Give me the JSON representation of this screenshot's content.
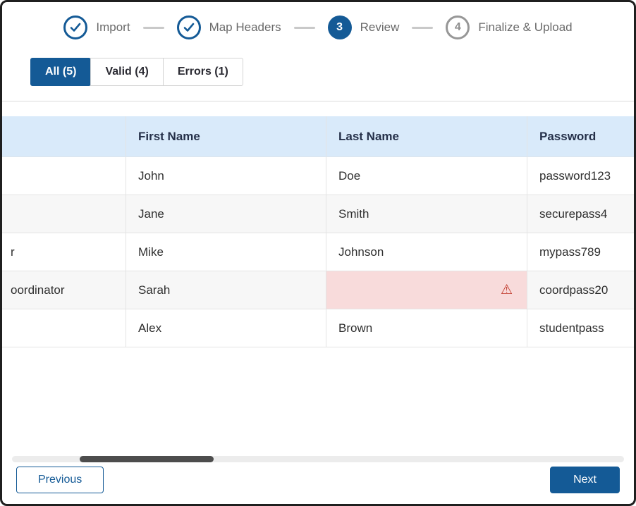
{
  "colors": {
    "primary": "#145a96",
    "table_header_bg": "#d9eafa",
    "row_stripe_bg": "#f7f7f7",
    "error_cell_bg": "#f8dbdb",
    "warning_red": "#c0392b",
    "step_todo_gray": "#8e8e8e"
  },
  "stepper": {
    "steps": [
      {
        "label": "Import",
        "state": "complete"
      },
      {
        "label": "Map Headers",
        "state": "complete"
      },
      {
        "number": "3",
        "label": "Review",
        "state": "active"
      },
      {
        "number": "4",
        "label": "Finalize & Upload",
        "state": "upcoming"
      }
    ]
  },
  "tabs": [
    {
      "label": "All (5)",
      "active": true
    },
    {
      "label": "Valid (4)",
      "active": false
    },
    {
      "label": "Errors (1)",
      "active": false
    }
  ],
  "table": {
    "columns": [
      "",
      "First Name",
      "Last Name",
      "Password"
    ],
    "rows": [
      {
        "col0_fragment": "",
        "first_name": "John",
        "last_name": "Doe",
        "password": "password123",
        "error_in_last_name": false
      },
      {
        "col0_fragment": "",
        "first_name": "Jane",
        "last_name": "Smith",
        "password": "securepass4",
        "error_in_last_name": false
      },
      {
        "col0_fragment": "r",
        "first_name": "Mike",
        "last_name": "Johnson",
        "password": "mypass789",
        "error_in_last_name": false
      },
      {
        "col0_fragment": "oordinator",
        "first_name": "Sarah",
        "last_name": "",
        "password": "coordpass20",
        "error_in_last_name": true
      },
      {
        "col0_fragment": "",
        "first_name": "Alex",
        "last_name": "Brown",
        "password": "studentpass",
        "error_in_last_name": false
      }
    ]
  },
  "icons": {
    "warning": "⚠"
  },
  "footer": {
    "previous_label": "Previous",
    "next_label": "Next"
  }
}
